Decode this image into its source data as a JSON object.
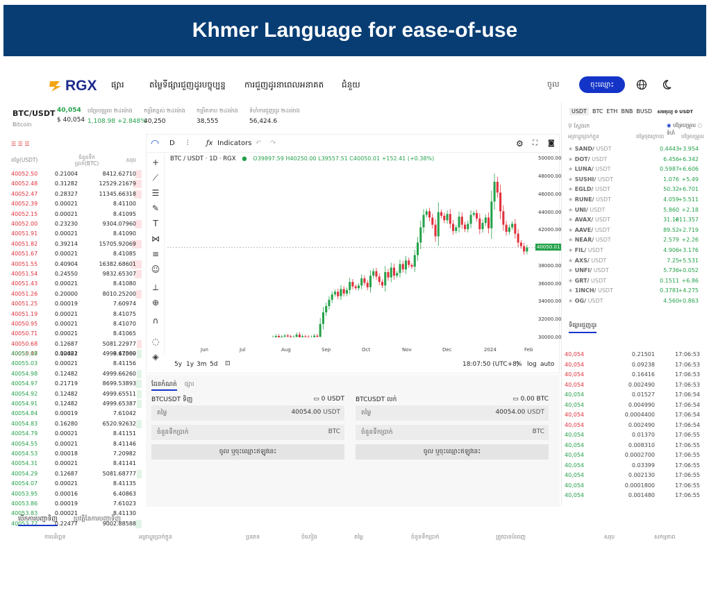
{
  "banner": {
    "title": "Khmer Language for ease-of-use"
  },
  "nav": {
    "logo": "RGX",
    "links": [
      "ផ្សារ",
      "តម្លៃទីផ្សារជួញដូរបច្ចុប្បន្ន",
      "ការជួញដូរនាពេលអនាគត",
      "ជំនួយ"
    ],
    "login": "ចូល",
    "signup": "ចុះឈ្មោះ",
    "icons": [
      "globe-icon",
      "moon-icon"
    ]
  },
  "ticker": {
    "symbol": "BTC/USDT",
    "sub": "Bitcoin",
    "price": "40,054",
    "price_usd": "$ 40,054",
    "items": [
      {
        "label": "បម្រែបម្រួល ២៤ម៉ោង",
        "value": "1,108.98",
        "value2": "+2.848%"
      },
      {
        "label": "កម្រិតខ្ពស់ ២៤ម៉ោង",
        "value": "40,250"
      },
      {
        "label": "កម្រិតទាប ២៤ម៉ោង",
        "value": "38,555"
      },
      {
        "label": "ទំហំការជួញដូរ ២៤ម៉ោង",
        "value": "56,424.6"
      }
    ]
  },
  "orderbook": {
    "headers": [
      "តម្លៃ(USDT)",
      "ចំនួនទឹកប្រាក់(BTC)",
      "សរុប"
    ],
    "asks": [
      [
        "40052.50",
        "0.21004",
        "8412.62710"
      ],
      [
        "40052.48",
        "0.31282",
        "12529.21679"
      ],
      [
        "40052.47",
        "0.28327",
        "11345.66318"
      ],
      [
        "40052.39",
        "0.00021",
        "8.41100"
      ],
      [
        "40052.15",
        "0.00021",
        "8.41095"
      ],
      [
        "40052.00",
        "0.23230",
        "9304.07960"
      ],
      [
        "40051.91",
        "0.00021",
        "8.41090"
      ],
      [
        "40051.82",
        "0.39214",
        "15705.92069"
      ],
      [
        "40051.67",
        "0.00021",
        "8.41085"
      ],
      [
        "40051.55",
        "0.40904",
        "16382.68601"
      ],
      [
        "40051.54",
        "0.24550",
        "9832.65307"
      ],
      [
        "40051.43",
        "0.00021",
        "8.41080"
      ],
      [
        "40051.26",
        "0.20000",
        "8010.25200"
      ],
      [
        "40051.25",
        "0.00019",
        "7.60974"
      ],
      [
        "40051.19",
        "0.00021",
        "8.41075"
      ],
      [
        "40050.95",
        "0.00021",
        "8.41070"
      ],
      [
        "40050.71",
        "0.00021",
        "8.41065"
      ],
      [
        "40050.68",
        "0.12687",
        "5081.22977"
      ],
      [
        "40050.47",
        "0.00021",
        "8.41060"
      ]
    ],
    "bids": [
      [
        "40055.08",
        "0.12482",
        "4999.67509"
      ],
      [
        "40055.03",
        "0.00021",
        "8.41156"
      ],
      [
        "40054.98",
        "0.12482",
        "4999.66260"
      ],
      [
        "40054.97",
        "0.21719",
        "8699.53893"
      ],
      [
        "40054.92",
        "0.12482",
        "4999.65511"
      ],
      [
        "40054.91",
        "0.12482",
        "4999.65387"
      ],
      [
        "40054.84",
        "0.00019",
        "7.61042"
      ],
      [
        "40054.83",
        "0.16280",
        "6520.92632"
      ],
      [
        "40054.79",
        "0.00021",
        "8.41151"
      ],
      [
        "40054.55",
        "0.00021",
        "8.41146"
      ],
      [
        "40054.53",
        "0.00018",
        "7.20982"
      ],
      [
        "40054.31",
        "0.00021",
        "8.41141"
      ],
      [
        "40054.29",
        "0.12687",
        "5081.68777"
      ],
      [
        "40054.07",
        "0.00021",
        "8.41135"
      ],
      [
        "40053.95",
        "0.00016",
        "6.40863"
      ],
      [
        "40053.86",
        "0.00019",
        "7.61023"
      ],
      [
        "40053.83",
        "0.00021",
        "8.41130"
      ],
      [
        "40053.77",
        "0.22477",
        "9002.88588"
      ]
    ]
  },
  "chart": {
    "interval": "D",
    "indicators": "Indicators",
    "title": "BTC / USDT · 1D · RGX",
    "ohlc": "O39897.59 H40250.00 L39557.51 C40050.01 +152.41 (+0.38%)",
    "last_price": "40050.01",
    "ranges": [
      "5y",
      "1y",
      "3m",
      "5d"
    ],
    "clock": "18:07:50 (UTC+8)",
    "percent": "%",
    "log": "log",
    "auto": "auto",
    "months": [
      "Jun",
      "Jul",
      "Aug",
      "Sep",
      "Oct",
      "Nov",
      "Dec",
      "2024",
      "Feb"
    ]
  },
  "chart_data": {
    "type": "candlestick",
    "yticks": [
      "50000.00",
      "48000.00",
      "46000.00",
      "44000.00",
      "42000.00",
      "40000.00",
      "38000.00",
      "36000.00",
      "34000.00",
      "32000.00",
      "30000.00"
    ],
    "ylim": [
      30000,
      50500
    ],
    "close": [
      30020,
      30150,
      29950,
      30080,
      30200,
      30100,
      29980,
      30050,
      30300,
      29900,
      30120,
      30050,
      29870,
      30020,
      30180,
      30060,
      31500,
      32800,
      33500,
      34200,
      34800,
      35100,
      34600,
      35400,
      34900,
      35300,
      36200,
      35700,
      35500,
      35800,
      36600,
      36100,
      35600,
      36900,
      37400,
      36800,
      36200,
      35800,
      37300,
      36700,
      37800,
      36900,
      37200,
      38200,
      37600,
      38600,
      38100,
      37900,
      39200,
      40600,
      42300,
      43700,
      44100,
      43400,
      42600,
      41300,
      44000,
      43600,
      43100,
      43800,
      42700,
      41900,
      42300,
      43500,
      42600,
      42100,
      42700,
      43700,
      43900,
      43300,
      42100,
      42800,
      43400,
      42200,
      45200,
      47400,
      46200,
      44100,
      42600,
      41800,
      42300,
      42700,
      41600,
      40600,
      40200,
      39600,
      40050
    ]
  },
  "trade_tabs": [
    "ដែនកំណត់",
    "ផ្សារ"
  ],
  "buy": {
    "title": "BTCUSDT ទិញ",
    "balance": "0 USDT",
    "price_label": "តម្លៃ",
    "price": "40054.00",
    "unit": "USDT",
    "amount_label": "ចំនួនទឹកប្រាក់",
    "amount_unit": "BTC",
    "button": "ចូល ឬចុះឈ្មោះឥឡូវនេះ"
  },
  "sell": {
    "title": "BTCUSDT លក់",
    "balance": "0.00 BTC",
    "price_label": "តម្លៃ",
    "price": "40054.00",
    "unit": "USDT",
    "amount_label": "ចំនួនទឹកប្រាក់",
    "amount_unit": "BTC",
    "button": "ចូល ឬចុះឈ្មោះឥឡូវនេះ"
  },
  "markets": {
    "tabs": [
      "USDT",
      "BTC",
      "ETH",
      "BNB",
      "BUSD"
    ],
    "volume": "សមតុល្យ 0 USDT",
    "search": "ស្វែងរក",
    "opt1": "បម្រែបម្រួល",
    "opt2": "ទំហំ",
    "headers": [
      "អត្រាប្តូរប្រាក់ក្លូន",
      "តម្លៃចុងក្រោយ",
      "បម្រែបម្រួល"
    ],
    "rows": [
      [
        "SAND/",
        "USDT",
        "0.4443",
        "+3.954"
      ],
      [
        "DOT/",
        "USDT",
        "6.456",
        "+6.342"
      ],
      [
        "LUNA/",
        "USDT",
        "0.5987",
        "+6.606"
      ],
      [
        "SUSHI/",
        "USDT",
        "1.076",
        "+5.49"
      ],
      [
        "EGLD/",
        "USDT",
        "50.32",
        "+6.701"
      ],
      [
        "RUNE/",
        "USDT",
        "4.059",
        "+5.511"
      ],
      [
        "UNI/",
        "USDT",
        "5.860",
        "+2.18"
      ],
      [
        "AVAX/",
        "USDT",
        "31.18",
        "+11.357"
      ],
      [
        "AAVE/",
        "USDT",
        "89.52",
        "+2.719"
      ],
      [
        "NEAR/",
        "USDT",
        "2.579",
        "+2.26"
      ],
      [
        "FIL/",
        "USDT",
        "4.906",
        "+3.176"
      ],
      [
        "AXS/",
        "USDT",
        "7.25",
        "+5.531"
      ],
      [
        "UNFI/",
        "USDT",
        "5.736",
        "+0.052"
      ],
      [
        "GRT/",
        "USDT",
        "0.1511",
        "+6.86"
      ],
      [
        "1INCH/",
        "USDT",
        "0.3781",
        "+4.275"
      ],
      [
        "OG/",
        "USDT",
        "4.560",
        "+0.863"
      ]
    ]
  },
  "trades": {
    "title": "ទិផ្សារជួញដូរ",
    "rows": [
      [
        "40,054",
        "0.21501",
        "17:06:53",
        "r"
      ],
      [
        "40,054",
        "0.09238",
        "17:06:53",
        "r"
      ],
      [
        "40,054",
        "0.16416",
        "17:06:53",
        "r"
      ],
      [
        "40,054",
        "0.002490",
        "17:06:53",
        "r"
      ],
      [
        "40,054",
        "0.01527",
        "17:06:54",
        "g"
      ],
      [
        "40,054",
        "0.004990",
        "17:06:54",
        "g"
      ],
      [
        "40,054",
        "0.0004400",
        "17:06:54",
        "r"
      ],
      [
        "40,054",
        "0.002490",
        "17:06:54",
        "r"
      ],
      [
        "40,054",
        "0.01370",
        "17:06:55",
        "g"
      ],
      [
        "40,054",
        "0.008310",
        "17:06:55",
        "g"
      ],
      [
        "40,054",
        "0.0002700",
        "17:06:55",
        "g"
      ],
      [
        "40,054",
        "0.03399",
        "17:06:55",
        "g"
      ],
      [
        "40,054",
        "0.002130",
        "17:06:55",
        "g"
      ],
      [
        "40,054",
        "0.0001800",
        "17:06:55",
        "g"
      ],
      [
        "40,054",
        "0.001480",
        "17:06:55",
        "g"
      ]
    ]
  },
  "orders": {
    "tabs": [
      "បើកការបញ្ជាទិញ",
      "ប្រវត្តិនៃការបញ្ជាទិញ"
    ],
    "cols": [
      "ការបរិច្ឆេទ",
      "អត្រាប្តូរប្រាក់ក្លូន",
      "ប្រភេទ",
      "ចំហៀង",
      "តម្លៃ",
      "ចំនួនទឹកប្រាក់",
      "ត្រូវបានបំពេញ",
      "សរុប",
      "សកម្មភាព"
    ]
  }
}
